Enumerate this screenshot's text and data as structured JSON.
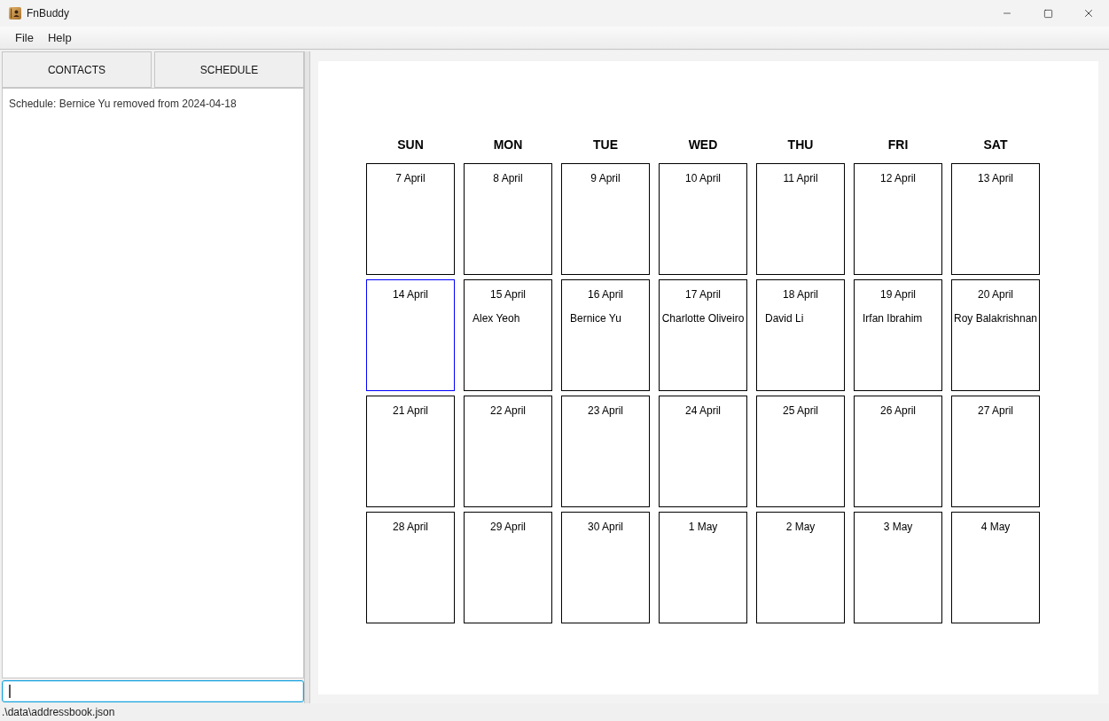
{
  "window": {
    "title": "FnBuddy"
  },
  "menu": [
    "File",
    "Help"
  ],
  "tabs": [
    {
      "label": "CONTACTS"
    },
    {
      "label": "SCHEDULE"
    }
  ],
  "result_display": {
    "text": "Schedule: Bernice Yu removed from 2024-04-18"
  },
  "command_box": {
    "focused": true
  },
  "calendar": {
    "days": [
      "SUN",
      "MON",
      "TUE",
      "WED",
      "THU",
      "FRI",
      "SAT"
    ],
    "weeks": [
      [
        {
          "date": "7 April",
          "selected": false
        },
        {
          "date": "8 April",
          "selected": false
        },
        {
          "date": "9 April",
          "selected": false
        },
        {
          "date": "10 April",
          "selected": false
        },
        {
          "date": "11 April",
          "selected": false
        },
        {
          "date": "12 April",
          "selected": false
        },
        {
          "date": "13 April",
          "selected": false
        }
      ],
      [
        {
          "date": "14 April",
          "selected": true
        },
        {
          "date": "15 April",
          "selected": false,
          "entries": [
            "Alex Yeoh"
          ]
        },
        {
          "date": "16 April",
          "selected": false,
          "entries": [
            "Bernice Yu"
          ]
        },
        {
          "date": "17 April",
          "selected": false,
          "entries": [
            "Charlotte Oliveiro"
          ]
        },
        {
          "date": "18 April",
          "selected": false,
          "entries": [
            "David Li"
          ]
        },
        {
          "date": "19 April",
          "selected": false,
          "entries": [
            "Irfan Ibrahim"
          ]
        },
        {
          "date": "20 April",
          "selected": false,
          "entries": [
            "Roy Balakrishnan"
          ]
        }
      ],
      [
        {
          "date": "21 April",
          "selected": false
        },
        {
          "date": "22 April",
          "selected": false
        },
        {
          "date": "23 April",
          "selected": false
        },
        {
          "date": "24 April",
          "selected": false
        },
        {
          "date": "25 April",
          "selected": false
        },
        {
          "date": "26 April",
          "selected": false
        },
        {
          "date": "27 April",
          "selected": false
        }
      ],
      [
        {
          "date": "28 April",
          "selected": false
        },
        {
          "date": "29 April",
          "selected": false
        },
        {
          "date": "30 April",
          "selected": false
        },
        {
          "date": "1 May",
          "selected": false
        },
        {
          "date": "2 May",
          "selected": false
        },
        {
          "date": "3 May",
          "selected": false
        },
        {
          "date": "4 May",
          "selected": false
        }
      ]
    ]
  },
  "status_bar": {
    "path": ".\\data\\addressbook.json"
  }
}
